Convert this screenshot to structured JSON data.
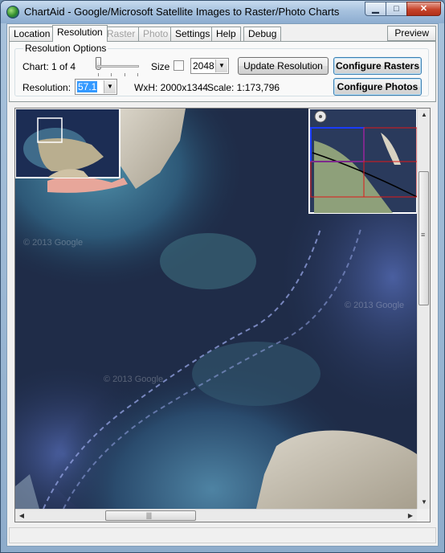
{
  "window": {
    "title": "ChartAid - Google/Microsoft Satellite Images to Raster/Photo Charts",
    "controls": {
      "minimize": "▁",
      "maximize": "□",
      "close": "✕"
    }
  },
  "tabs": [
    {
      "label": "Location",
      "state": "normal"
    },
    {
      "label": "Resolution",
      "state": "active"
    },
    {
      "label": "Raster",
      "state": "disabled"
    },
    {
      "label": "Photo",
      "state": "disabled"
    },
    {
      "label": "Settings",
      "state": "normal"
    },
    {
      "label": "Help",
      "state": "normal"
    },
    {
      "label": "Debug",
      "state": "normal"
    }
  ],
  "preview_button": "Preview",
  "resolution_options": {
    "group_title": "Resolution Options",
    "chart_label": "Chart:  1 of 4",
    "chart_slider_position": 0,
    "size_label": "Size",
    "size_checked": false,
    "size_value": "2048",
    "update_button": "Update Resolution",
    "configure_rasters_button": "Configure Rasters",
    "configure_photos_button": "Configure Photos",
    "resolution_label": "Resolution:",
    "resolution_value": "57.1",
    "wxh_text": "WxH: 2000x1344",
    "scale_text": "Scale: 1:173,796"
  },
  "map": {
    "watermarks": [
      "© 2013 Google",
      "© 2013 Google",
      "© 2013 Google"
    ],
    "overview_inset": "overview map with selection box",
    "grid_inset": "chart tile grid overlay"
  },
  "scrollbars": {
    "vertical_position": 0.35,
    "horizontal_position": 0.28
  },
  "colors": {
    "water_dark": "#1a2640",
    "water_light": "#4f86a8",
    "land": "#b9b3a4",
    "grid_blue": "#1a3cff",
    "grid_red": "#e01818"
  }
}
